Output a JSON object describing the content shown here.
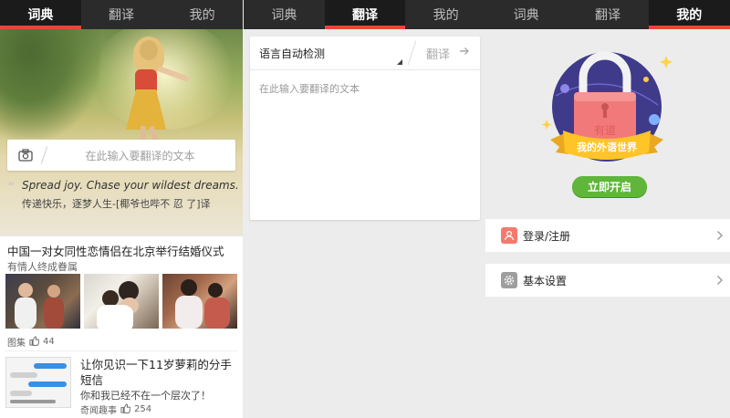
{
  "tabs": [
    "词典",
    "翻译",
    "我的"
  ],
  "panel1": {
    "search_placeholder": "在此输入要翻译的文本",
    "quote_en": "Spread joy. Chase your wildest dreams.",
    "quote_cn": "传递快乐，逐梦人生-[椰爷也哔不 忍 了]译",
    "news1": {
      "title": "中国一对女同性恋情侣在北京举行结婚仪式",
      "subtitle": "有情人终成眷属",
      "category": "图集",
      "likes": "44"
    },
    "news2": {
      "title": "让你见识一下11岁萝莉的分手短信",
      "subtitle": "你和我已经不在一个层次了！",
      "category": "奇闻趣事",
      "likes": "254"
    }
  },
  "panel2": {
    "lang_select": "语言自动检测",
    "translate_label": "翻译",
    "input_placeholder": "在此输入要翻译的文本"
  },
  "panel3": {
    "banner_text": "我的外语世界",
    "lock_text": "有道",
    "login_button": "立即开启",
    "menu": [
      {
        "label": "登录/注册",
        "icon": "user-icon",
        "color": "#f27a6e"
      },
      {
        "label": "基本设置",
        "icon": "gear-icon",
        "color": "#9e9e9e"
      }
    ]
  },
  "colors": {
    "accent": "#e8463a",
    "topbar": "#2b2b2b",
    "green": "#5fb63a"
  }
}
